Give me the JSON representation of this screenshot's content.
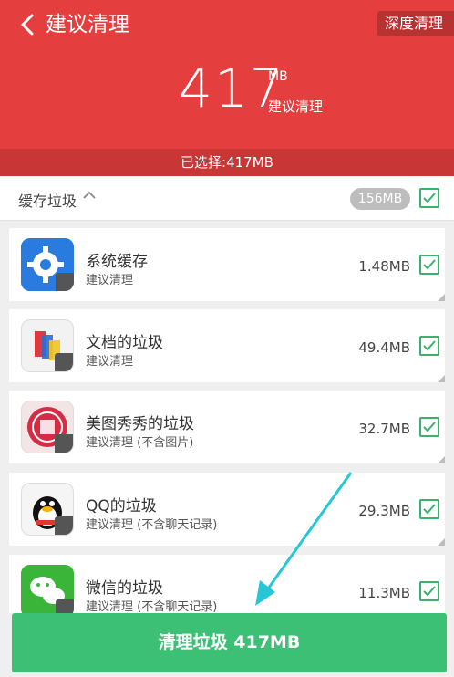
{
  "header": {
    "title": "建议清理",
    "deep_clean_label": "深度清理",
    "total_value": "417",
    "total_unit": "MB",
    "total_caption": "建议清理",
    "selected_text": "已选择:417MB",
    "background_color": "#e53e3e"
  },
  "section": {
    "label": "缓存垃圾",
    "size": "156MB",
    "checked": true
  },
  "items": [
    {
      "name": "系统缓存",
      "desc": "建议清理",
      "size": "1.48MB",
      "icon": "system-cache-icon",
      "checked": true
    },
    {
      "name": "文档的垃圾",
      "desc": "建议清理",
      "size": "49.4MB",
      "icon": "documents-icon",
      "checked": true
    },
    {
      "name": "美图秀秀的垃圾",
      "desc": "建议清理 (不含图片)",
      "size": "32.7MB",
      "icon": "meitu-icon",
      "checked": true
    },
    {
      "name": "QQ的垃圾",
      "desc": "建议清理 (不含聊天记录)",
      "size": "29.3MB",
      "icon": "qq-icon",
      "checked": true
    },
    {
      "name": "微信的垃圾",
      "desc": "建议清理 (不含聊天记录)",
      "size": "11.3MB",
      "icon": "wechat-icon",
      "checked": true
    }
  ],
  "clean_button": {
    "label": "清理垃圾 417MB",
    "color": "#3cc076"
  },
  "check_color": "#39b36b"
}
